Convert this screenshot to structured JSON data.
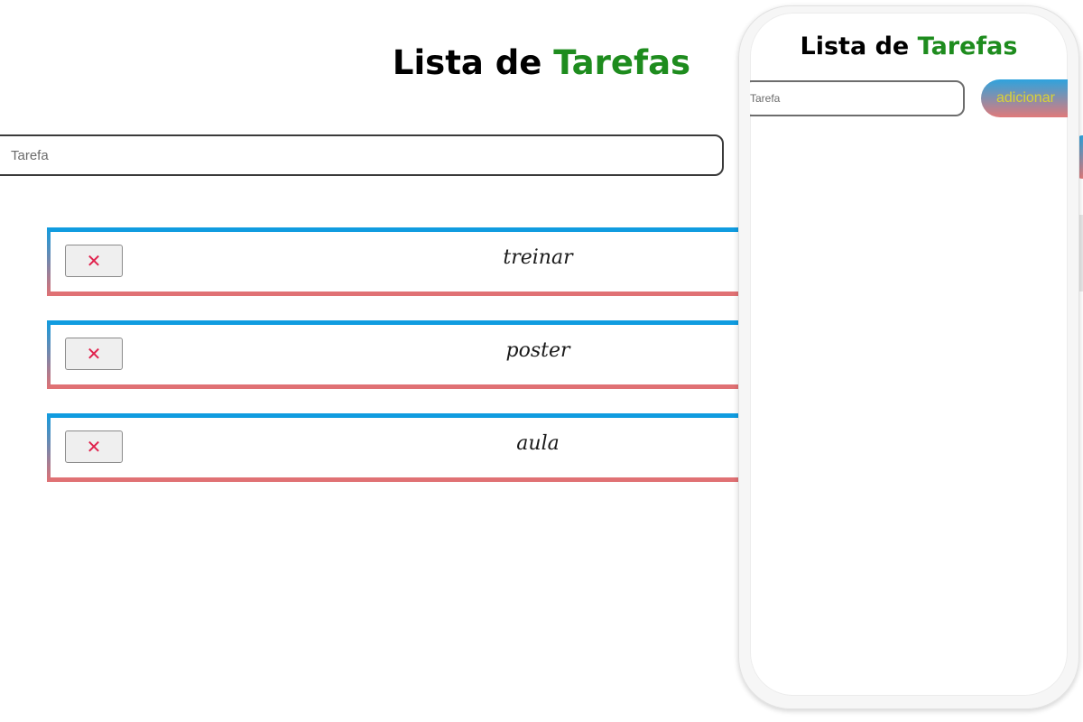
{
  "desktop": {
    "title_main": "Lista de",
    "title_accent": "Tarefas",
    "input_placeholder": "Tarefa",
    "tasks": [
      {
        "label": "treinar",
        "delete_label": "✕"
      },
      {
        "label": "poster",
        "delete_label": "✕"
      },
      {
        "label": "aula",
        "delete_label": "✕"
      }
    ]
  },
  "mobile": {
    "title_main": "Lista de",
    "title_accent": "Tarefas",
    "input_placeholder": "Tarefa",
    "add_label": "adicionar"
  },
  "colors": {
    "accent_green": "#1e8c1e",
    "task_border_top": "#109ce0",
    "task_border_bottom": "#e07174",
    "delete_icon": "#e0224d",
    "add_button_text": "#d7d338"
  }
}
